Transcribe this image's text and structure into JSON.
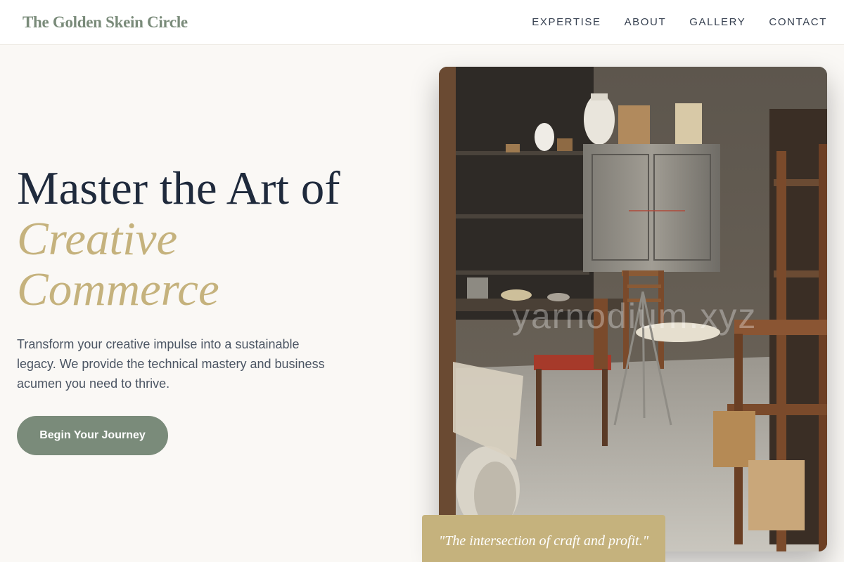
{
  "header": {
    "brand": "The Golden Skein Circle",
    "nav": [
      {
        "label": "EXPERTISE"
      },
      {
        "label": "ABOUT"
      },
      {
        "label": "GALLERY"
      },
      {
        "label": "CONTACT"
      }
    ]
  },
  "hero": {
    "title_line1": "Master the Art of",
    "title_accent_line1": "Creative",
    "title_accent_line2": "Commerce",
    "subtitle": "Transform your creative impulse into a sustainable legacy. We provide the technical mastery and business acumen you need to thrive.",
    "cta_label": "Begin Your Journey"
  },
  "image": {
    "watermark": "yarnodium.xyz",
    "alt": "Cluttered artisan workshop with wooden chairs, shelves of pottery and a metal cabinet"
  },
  "quote": {
    "text": "\"The intersection of craft and profit.\""
  },
  "colors": {
    "sage": "#7a8b7a",
    "gold": "#c5b27d",
    "navy": "#1f2a3c",
    "background": "#faf8f5"
  }
}
